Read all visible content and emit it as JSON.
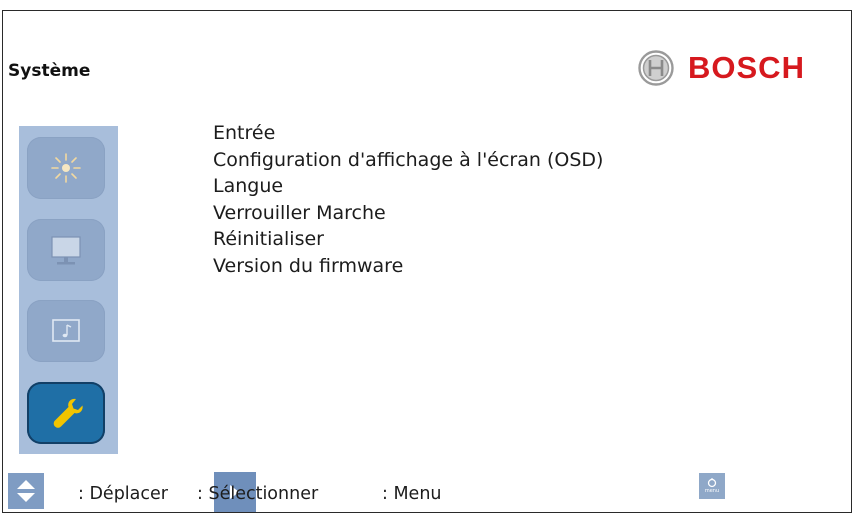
{
  "header": {
    "title": "Système",
    "brand": "BOSCH"
  },
  "sidebar": {
    "items": [
      {
        "name": "brightness",
        "icon": "sun-icon",
        "active": false
      },
      {
        "name": "display",
        "icon": "monitor-icon",
        "active": false
      },
      {
        "name": "audio",
        "icon": "music-note-icon",
        "active": false
      },
      {
        "name": "system",
        "icon": "wrench-icon",
        "active": true
      }
    ],
    "colors": {
      "panel": "#a8bedb",
      "button": "#90a8c9",
      "active": "#1f6fa6",
      "wrench": "#f2c400"
    }
  },
  "menu": {
    "items": [
      "Entrée",
      "Configuration d'affichage à l'écran (OSD)",
      "Langue",
      "Verrouiller Marche",
      "Réinitialiser",
      "Version du firmware"
    ]
  },
  "footer": {
    "move_label": ": Déplacer",
    "select_label": ": Sélectionner",
    "menu_label": ": Menu",
    "menu_icon_label": "menu"
  },
  "colors": {
    "brand": "#d6191e"
  }
}
